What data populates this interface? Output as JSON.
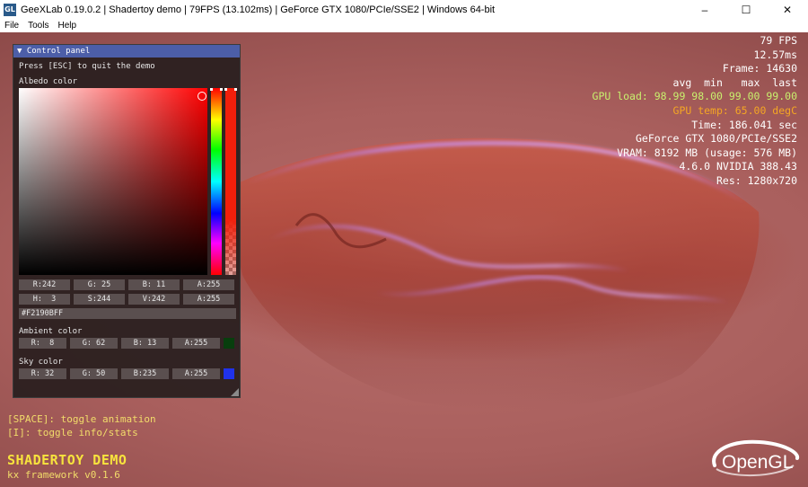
{
  "window": {
    "title": "GeeXLab 0.19.0.2 | Shadertoy demo | 79FPS (13.102ms) | GeForce GTX 1080/PCIe/SSE2 | Windows 64-bit",
    "icon_text": "GL",
    "controls": {
      "minimize": "–",
      "maximize": "☐",
      "close": "✕"
    }
  },
  "menu": {
    "items": [
      "File",
      "Tools",
      "Help"
    ]
  },
  "hud": {
    "fps": "79 FPS",
    "ms": "12.57ms",
    "frame": "Frame: 14630",
    "stats_header": "avg  min   max  last",
    "gpu_load": "GPU load: 98.99 98.00 99.00 99.00",
    "gpu_temp": "GPU temp: 65.00 degC",
    "time": "Time: 186.041 sec",
    "gpu_name": "GeForce GTX 1080/PCIe/SSE2",
    "vram": "VRAM: 8192 MB (usage: 576 MB)",
    "driver": "4.6.0 NVIDIA 388.43",
    "resolution": "Res: 1280x720"
  },
  "panel": {
    "header": "▼ Control panel",
    "esc_hint": "Press [ESC] to quit the demo",
    "albedo": {
      "label": "Albedo color",
      "rgba": [
        "R:242",
        "G: 25",
        "B: 11",
        "A:255"
      ],
      "hsv": [
        "H:  3",
        "S:244",
        "V:242",
        "A:255"
      ],
      "hex": "#F2190BFF",
      "color": "#f2190b"
    },
    "ambient": {
      "label": "Ambient color",
      "rgba": [
        "R:  8",
        "G: 62",
        "B: 13",
        "A:255"
      ],
      "color": "#083e0d"
    },
    "sky": {
      "label": "Sky color",
      "rgba": [
        "R: 32",
        "G: 50",
        "B:235",
        "A:255"
      ],
      "color": "#2032eb"
    }
  },
  "hints": {
    "space": "[SPACE]: toggle animation",
    "info": "[I]: toggle info/stats"
  },
  "demo": {
    "title": "SHADERTOY DEMO",
    "framework": "kx framework v0.1.6"
  },
  "logo": {
    "text": "OpenGL"
  },
  "colors": {
    "panel_header": "#4c5ea8",
    "hud_text": "#ffffff",
    "gpu_load": "#c8f06e",
    "gpu_temp": "#f5a623",
    "hint_text": "#f2dc6a"
  }
}
